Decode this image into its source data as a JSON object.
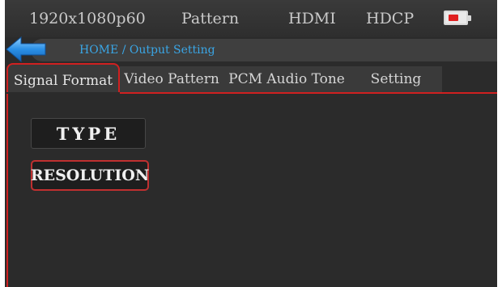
{
  "status_bar": {
    "resolution": "1920x1080p60",
    "mode": "Pattern",
    "interface": "HDMI",
    "hdcp": "HDCP",
    "battery_icon": "battery-low-icon",
    "battery_color": "#e02020"
  },
  "nav": {
    "back_icon": "back-arrow-icon",
    "breadcrumb": "HOME / Output Setting",
    "accent_color": "#3aa6e6"
  },
  "tabs": [
    {
      "label": "Signal Format",
      "active": true
    },
    {
      "label": "Video Pattern",
      "active": false
    },
    {
      "label": "PCM Audio Tone",
      "active": false
    },
    {
      "label": "Setting",
      "active": false
    }
  ],
  "content": {
    "type_button": "TYPE",
    "resolution_button": "RESOLUTION"
  },
  "colors": {
    "highlight": "#d02020",
    "background": "#2b2b2b"
  }
}
